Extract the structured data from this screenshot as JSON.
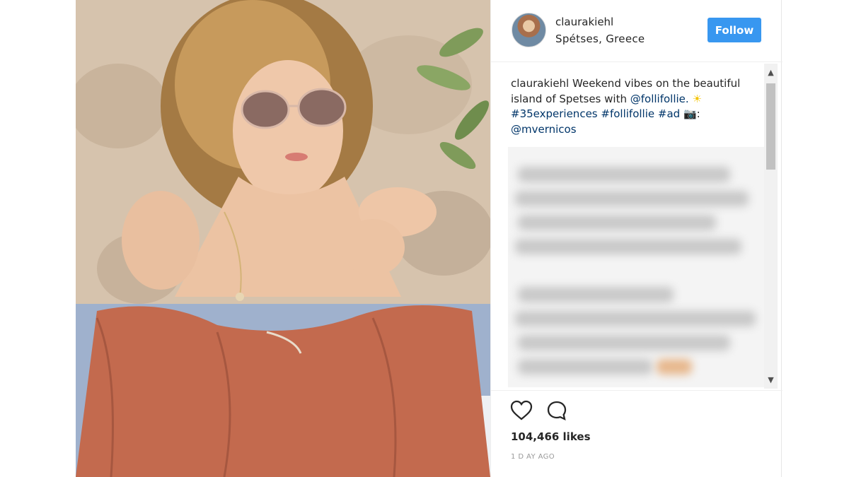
{
  "post": {
    "username": "claurakiehl",
    "location": "Spétses, Greece",
    "follow_label": "Follow",
    "caption": {
      "author": "claurakiehl",
      "text": "Weekend vibes on the beautiful island of Spetses with",
      "mention": "@follifollie.",
      "sun_emoji": "☀",
      "hashtag1": "#35experiences",
      "hashtag2": "#follifollie",
      "hashtag3": "#ad",
      "camera_emoji": "📷",
      "photographer": "@mvernicos"
    },
    "likes": "104,466 likes",
    "timestamp": "1 D AY AGO"
  },
  "scrollbar": {
    "up_arrow": "▲",
    "down_arrow": "▼"
  },
  "icons": [
    "heart-icon",
    "comment-icon",
    "avatar"
  ],
  "colors": {
    "follow_button": "#3897f0",
    "link": "#003569",
    "text": "#262626"
  }
}
